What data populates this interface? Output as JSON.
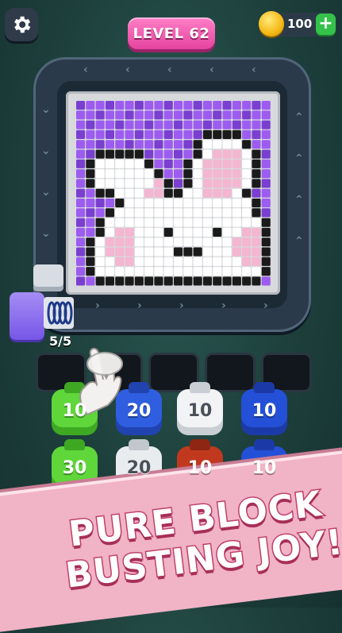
{
  "header": {
    "level_label": "LEVEL 62",
    "coins": "100",
    "plus_symbol": "+",
    "settings_icon": "gear-icon",
    "coin_icon": "coin-icon"
  },
  "shooter": {
    "count": "5/5",
    "color": "#8a6ff0"
  },
  "pixel_art": {
    "colors": {
      "purple_dark": "#7a3fd0",
      "purple": "#9d5cf0",
      "white": "#ffffff",
      "pink": "#f4b6d0",
      "black": "#1a1a1a"
    },
    "cols": 20,
    "rows": 19,
    "grid": [
      "PPPPPPPPPPPPPPPPPPPP",
      "PPPPPPPPPPPPPPPPPPPP",
      "PPPPPPPPPPPPPPPPPPPP",
      "PPPPPPPPPPPPPBBBBPPP",
      "PPPPPPPPPPPPBWWWWBPP",
      "PPBBBBBPPPPPBWpppWBP",
      "PBWWWWWBPPPBWppppWBP",
      "PBWWWWWWBPPBWppppWBP",
      "PBWWWWWWpBPBWppppWBP",
      "PPBBWWWppBBWWpppWBPP",
      "PPPPBWWWWWWWWWWWWWBP",
      "PPPBWWWWWWWWWWWWWWBP",
      "PPBWWWWWWWWWWWWWWWWB",
      "PPBWppWWWBWWWWBWWppB",
      "PBWpppWWWWWWWWWWpppB",
      "PBWpppWWWWBBBWWWpppB",
      "PBWWppWWWWWWWWWWWppB",
      "PBWWWWWWWWWWWWWWWWWB",
      "PPBBBBBBBBBBBBBBBBBP"
    ]
  },
  "slots": [
    1,
    2,
    3,
    4,
    5
  ],
  "blocks": [
    {
      "value": "10",
      "color": "#5fd63a",
      "cap": "#3ea823"
    },
    {
      "value": "20",
      "color": "#2f5ee0",
      "cap": "#2143b0"
    },
    {
      "value": "10",
      "color": "#f1f3f5",
      "cap": "#c9ced4",
      "dark": true
    },
    {
      "value": "10",
      "color": "#2450d8",
      "cap": "#1c3aa7"
    },
    {
      "value": "30",
      "color": "#5fd63a",
      "cap": "#3ea823"
    },
    {
      "value": "20",
      "color": "#e9ecef",
      "cap": "#c1c7cd",
      "dark": true
    },
    {
      "value": "10",
      "color": "#c0391f",
      "cap": "#8f2613"
    },
    {
      "value": "10",
      "color": "#2450d8",
      "cap": "#1c3aa7"
    }
  ],
  "banner": {
    "line1": "PURE BLOCK",
    "line2": "BUSTING JOY!"
  }
}
